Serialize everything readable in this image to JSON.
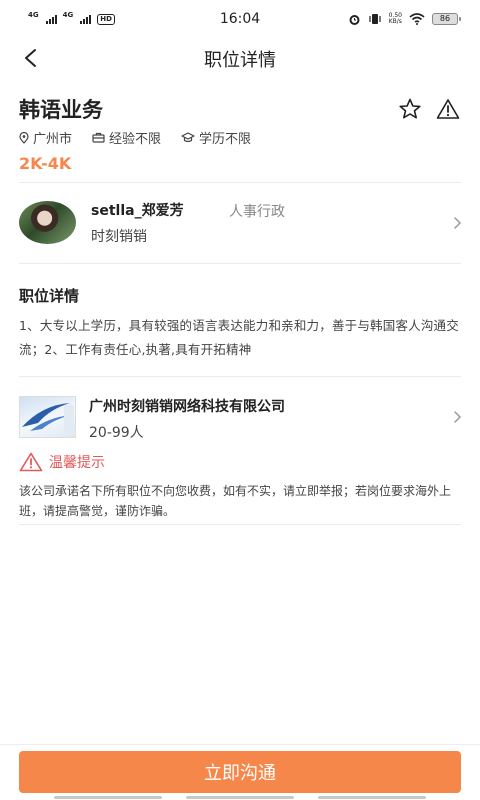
{
  "status_bar": {
    "network1": "4G",
    "network2": "4G",
    "hd": "HD",
    "time": "16:04",
    "speed_value": "0.50",
    "speed_unit": "KB/s",
    "battery": "86"
  },
  "nav": {
    "title": "职位详情"
  },
  "job": {
    "title": "韩语业务",
    "location": "广州市",
    "experience": "经验不限",
    "education": "学历不限",
    "salary": "2K-4K"
  },
  "recruiter": {
    "name": "setlla_郑爱芳",
    "role": "人事行政",
    "company": "时刻销销"
  },
  "details": {
    "title": "职位详情",
    "description": "1、大专以上学历，具有较强的语言表达能力和亲和力，善于与韩国客人沟通交流；2、工作有责任心,执著,具有开拓精神"
  },
  "company": {
    "name": "广州时刻销销网络科技有限公司",
    "size": "20-99人"
  },
  "tip": {
    "title": "温馨提示",
    "text": "该公司承诺名下所有职位不向您收费，如有不实，请立即举报；若岗位要求海外上班，请提高警觉，谨防诈骗。"
  },
  "action": {
    "chat_label": "立即沟通"
  },
  "colors": {
    "accent": "#f5874a",
    "warning": "#e05a5a"
  }
}
